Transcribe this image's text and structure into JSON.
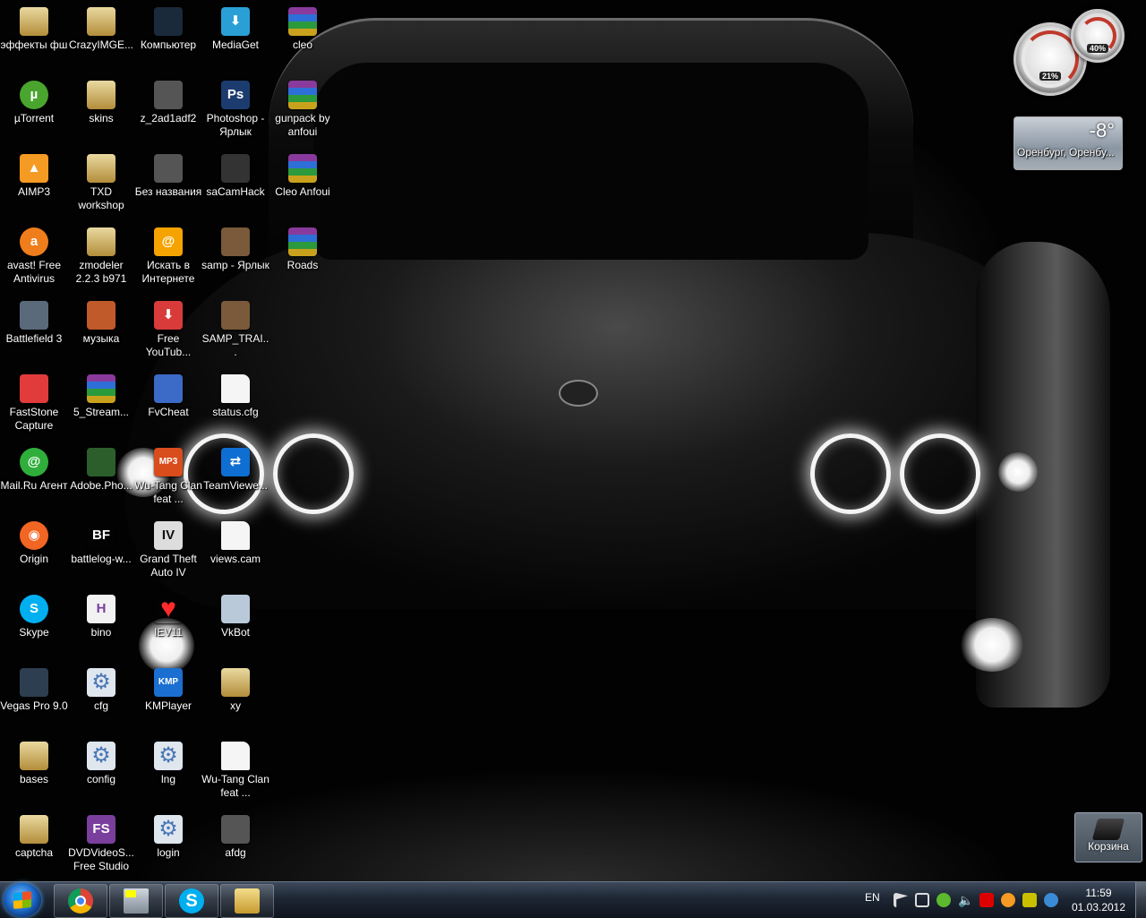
{
  "desktop": {
    "icons": [
      {
        "label": "эффекты фш",
        "icon": "folder-icon"
      },
      {
        "label": "µTorrent",
        "icon": "utorrent-icon"
      },
      {
        "label": "AIMP3",
        "icon": "aimp-icon"
      },
      {
        "label": "avast! Free Antivirus",
        "icon": "avast-icon"
      },
      {
        "label": "Battlefield 3",
        "icon": "battlefield-icon"
      },
      {
        "label": "FastStone Capture",
        "icon": "faststone-icon"
      },
      {
        "label": "Mail.Ru Агент",
        "icon": "mailru-agent-icon"
      },
      {
        "label": "Origin",
        "icon": "origin-icon"
      },
      {
        "label": "Skype",
        "icon": "skype-icon"
      },
      {
        "label": "Vegas Pro 9.0",
        "icon": "vegas-icon"
      },
      {
        "label": "bases",
        "icon": "archive-folder-icon"
      },
      {
        "label": "captcha",
        "icon": "archive-folder-icon"
      },
      {
        "label": "CrazyIMGE...",
        "icon": "archive-folder-icon"
      },
      {
        "label": "skins",
        "icon": "archive-folder-icon"
      },
      {
        "label": "TXD workshop",
        "icon": "archive-folder-icon"
      },
      {
        "label": "zmodeler 2.2.3 b971",
        "icon": "archive-folder-icon"
      },
      {
        "label": "музыка",
        "icon": "music-folder-icon"
      },
      {
        "label": "5_Stream...",
        "icon": "winrar-icon"
      },
      {
        "label": "Adobe.Pho...",
        "icon": "adobe-photo-icon"
      },
      {
        "label": "battlelog-w...",
        "icon": "battlelog-icon"
      },
      {
        "label": "bino",
        "icon": "bino-icon"
      },
      {
        "label": "cfg",
        "icon": "config-file-icon"
      },
      {
        "label": "config",
        "icon": "config-file-icon"
      },
      {
        "label": "DVDVideoS... Free Studio",
        "icon": "dvdvideosoft-icon"
      },
      {
        "label": "Компьютер",
        "icon": "computer-icon"
      },
      {
        "label": "z_2ad1adf2",
        "icon": "image-icon"
      },
      {
        "label": "Без названия",
        "icon": "image-icon"
      },
      {
        "label": "Искать в Интернете",
        "icon": "search-web-icon"
      },
      {
        "label": "Free YouTub...",
        "icon": "youtube-downloader-icon"
      },
      {
        "label": "FvCheat",
        "icon": "fvcheat-icon"
      },
      {
        "label": "Wu-Tang Clan feat ...",
        "icon": "mp3-icon"
      },
      {
        "label": "Grand Theft Auto IV",
        "icon": "gta-iv-icon"
      },
      {
        "label": "IEV11",
        "icon": "heart-icon"
      },
      {
        "label": "KMPlayer",
        "icon": "kmplayer-icon"
      },
      {
        "label": "lng",
        "icon": "config-file-icon"
      },
      {
        "label": "login",
        "icon": "config-file-icon"
      },
      {
        "label": "MediaGet",
        "icon": "mediaget-icon"
      },
      {
        "label": "Photoshop - Ярлык",
        "icon": "photoshop-icon"
      },
      {
        "label": "saCamHack",
        "icon": "camera-icon"
      },
      {
        "label": "samp - Ярлык",
        "icon": "samp-icon"
      },
      {
        "label": "SAMP_TRAI...",
        "icon": "samp-icon"
      },
      {
        "label": "status.cfg",
        "icon": "blank-file-icon"
      },
      {
        "label": "TeamViewe...",
        "icon": "teamviewer-icon"
      },
      {
        "label": "views.cam",
        "icon": "blank-file-icon"
      },
      {
        "label": "VkBot",
        "icon": "vkbot-icon"
      },
      {
        "label": "xy",
        "icon": "archive-folder-icon"
      },
      {
        "label": "Wu-Tang Clan feat ...",
        "icon": "blank-file-icon"
      },
      {
        "label": "afdg",
        "icon": "image-icon"
      },
      {
        "label": "cleo",
        "icon": "winrar-icon"
      },
      {
        "label": "gunpack by anfoui",
        "icon": "winrar-icon"
      },
      {
        "label": "Cleo Anfoui",
        "icon": "winrar-icon"
      },
      {
        "label": "Roads",
        "icon": "winrar-icon"
      }
    ]
  },
  "gadgets": {
    "cpu_meter": {
      "cpu_value": "21%",
      "memory_value": "40%"
    },
    "weather": {
      "temperature": "-8°",
      "city": "Оренбург, Оренбу..."
    }
  },
  "recycle_bin": {
    "label": "Корзина"
  },
  "taskbar": {
    "pinned": [
      {
        "name": "chrome-icon"
      },
      {
        "name": "cpu-gadget-app-icon"
      },
      {
        "name": "skype-icon"
      },
      {
        "name": "explorer-icon"
      }
    ],
    "language": "EN",
    "clock": {
      "time": "11:59",
      "date": "01.03.2012"
    }
  },
  "colors": {
    "accent": "#1f6fd0",
    "taskbar": "#1d2633"
  }
}
